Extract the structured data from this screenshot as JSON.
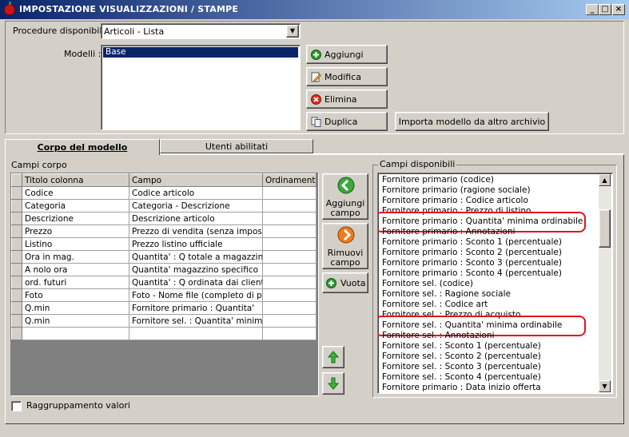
{
  "window": {
    "title": "IMPOSTAZIONE VISUALIZZAZIONI / STAMPE",
    "minimize": "_",
    "maximize": "□",
    "close": "×"
  },
  "procedure": {
    "label": "Procedure disponibili :",
    "value": "Articoli - Lista"
  },
  "models": {
    "label": "Modelli :",
    "items": [
      "Base"
    ],
    "selected": "Base"
  },
  "buttons": {
    "add": "Aggiungi",
    "edit": "Modifica",
    "delete": "Elimina",
    "duplicate": "Duplica",
    "import": "Importa modello da altro archivio"
  },
  "tabs": [
    {
      "label": "Corpo del modello",
      "active": true
    },
    {
      "label": "Utenti abilitati",
      "active": false
    }
  ],
  "body_fields": {
    "group_label": "Campi corpo",
    "columns": [
      "Titolo colonna",
      "Campo",
      "Ordinamento"
    ],
    "rows": [
      [
        "Codice",
        "Codice articolo",
        ""
      ],
      [
        "Categoria",
        "Categoria - Descrizione",
        ""
      ],
      [
        "Descrizione",
        "Descrizione articolo",
        ""
      ],
      [
        "Prezzo",
        "Prezzo di vendita (senza imposte)",
        ""
      ],
      [
        "Listino",
        "Prezzo listino ufficiale",
        ""
      ],
      [
        "Ora in mag.",
        "Quantita' : Q totale a magazzino",
        ""
      ],
      [
        "A nolo ora",
        "Quantita' magazzino specifico",
        ""
      ],
      [
        "ord. futuri",
        "Quantita' : Q ordinata dai clienti",
        ""
      ],
      [
        "Foto",
        "Foto - Nome file (completo di path",
        ""
      ],
      [
        "Q.min",
        "Fornitore primario : Quantita'",
        ""
      ],
      [
        "Q.min",
        "Fornitore sel. : Quantita' minima",
        ""
      ],
      [
        "",
        "",
        ""
      ]
    ]
  },
  "middle_buttons": {
    "add_field": [
      "Aggiungi",
      "campo"
    ],
    "remove_field": [
      "Rimuovi",
      "campo"
    ],
    "empty": "Vuota"
  },
  "available_fields": {
    "group_label": "Campi disponibili",
    "items": [
      "Fornitore primario (codice)",
      "Fornitore primario (ragione sociale)",
      "Fornitore primario : Codice articolo",
      "Fornitore primario : Prezzo di listino",
      "Fornitore primario : Quantita' minima ordinabile",
      "Fornitore primario : Annotazioni",
      "Fornitore primario : Sconto 1 (percentuale)",
      "Fornitore primario : Sconto 2 (percentuale)",
      "Fornitore primario : Sconto 3 (percentuale)",
      "Fornitore primario : Sconto 4 (percentuale)",
      "Fornitore sel. (codice)",
      "Fornitore sel. : Ragione sociale",
      "Fornitore sel. : Codice art",
      "Fornitore sel. : Prezzo di acquisto",
      "Fornitore sel. : Quantita' minima ordinabile",
      "Fornitore sel. : Annotazioni",
      "Fornitore sel. : Sconto 1 (percentuale)",
      "Fornitore sel. : Sconto 2 (percentuale)",
      "Fornitore sel. : Sconto 3 (percentuale)",
      "Fornitore sel. : Sconto 4 (percentuale)",
      "Fornitore primario : Data inizio offerta"
    ],
    "highlighted": [
      "Fornitore primario : Quantita' minima ordinabile",
      "Fornitore sel. : Quantita' minima ordinabile"
    ]
  },
  "grouping": {
    "label": "Raggruppamento valori",
    "checked": false
  },
  "colors": {
    "titlebar_start": "#0a246a",
    "titlebar_end": "#a6caf0",
    "selection": "#0a246a",
    "highlight_oval": "#e0141e"
  },
  "icons": {
    "add": "plus-circle-green-icon",
    "edit": "pencil-document-icon",
    "delete": "x-circle-red-icon",
    "duplicate": "copy-documents-icon",
    "add_field": "arrow-left-green-icon",
    "remove_field": "arrow-right-orange-icon",
    "move_up": "arrow-up-green-icon",
    "move_down": "arrow-down-green-icon"
  }
}
